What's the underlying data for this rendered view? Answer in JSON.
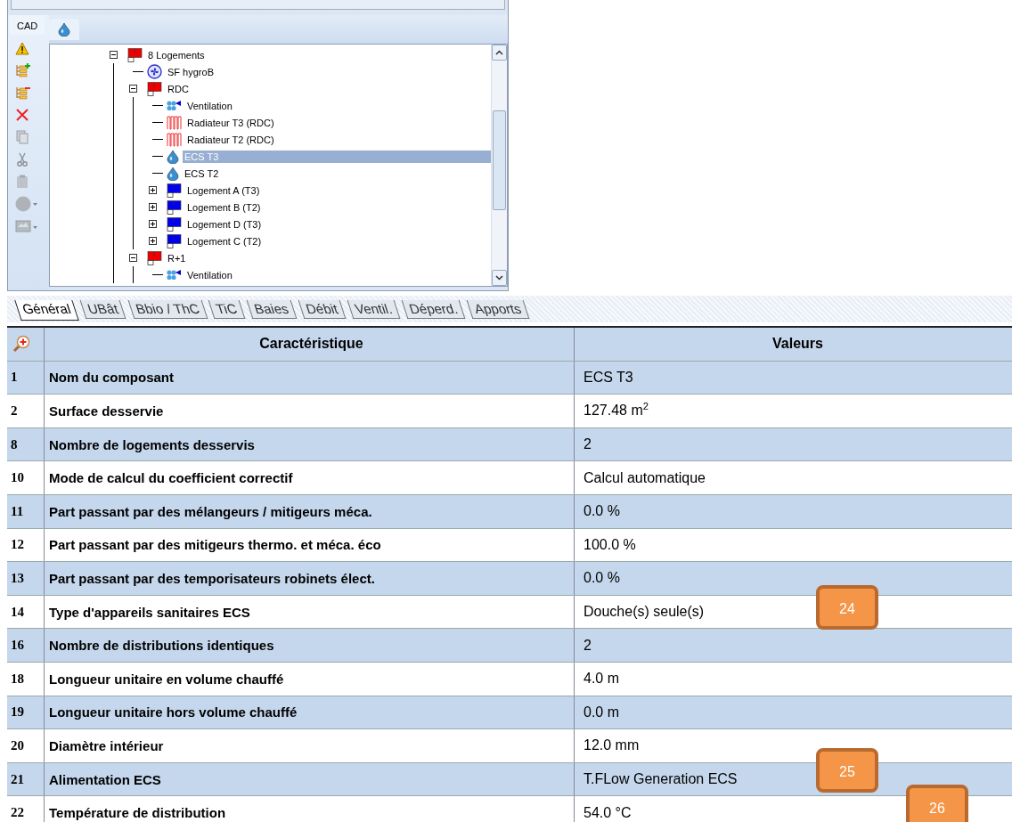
{
  "sidebar": {
    "tab": "CAD",
    "tools": [
      {
        "kind": "warning",
        "disabled": false
      },
      {
        "kind": "list-add",
        "disabled": false
      },
      {
        "kind": "list-remove",
        "disabled": false
      },
      {
        "kind": "delete",
        "disabled": false
      },
      {
        "kind": "copy",
        "disabled": true
      },
      {
        "kind": "cut",
        "disabled": true
      },
      {
        "kind": "paste",
        "disabled": true
      },
      {
        "kind": "circle-menu",
        "disabled": true
      },
      {
        "kind": "image-menu",
        "disabled": true
      }
    ]
  },
  "tree": {
    "items": [
      {
        "label": "8 Logements",
        "kind": "group-red",
        "expanded": true,
        "selected": false,
        "children": [
          {
            "label": "SF hygroB",
            "kind": "fan",
            "selected": false
          },
          {
            "label": "RDC",
            "kind": "group-red",
            "expanded": true,
            "selected": false,
            "children": [
              {
                "label": "Ventilation",
                "kind": "ventilation",
                "selected": false
              },
              {
                "label": "Radiateur T3 (RDC)",
                "kind": "radiator",
                "selected": false
              },
              {
                "label": "Radiateur T2 (RDC)",
                "kind": "radiator",
                "selected": false
              },
              {
                "label": "ECS T3",
                "kind": "drop",
                "selected": true
              },
              {
                "label": "ECS T2",
                "kind": "drop",
                "selected": false
              },
              {
                "label": "Logement A (T3)",
                "kind": "group-blue",
                "expanded": false,
                "selected": false
              },
              {
                "label": "Logement B (T2)",
                "kind": "group-blue",
                "expanded": false,
                "selected": false
              },
              {
                "label": "Logement D (T3)",
                "kind": "group-blue",
                "expanded": false,
                "selected": false
              },
              {
                "label": "Logement C (T2)",
                "kind": "group-blue",
                "expanded": false,
                "selected": false
              }
            ]
          },
          {
            "label": "R+1",
            "kind": "group-red",
            "expanded": true,
            "selected": false,
            "children": [
              {
                "label": "Ventilation",
                "kind": "ventilation",
                "selected": false
              }
            ]
          }
        ]
      }
    ]
  },
  "tabs": [
    {
      "label": "Général",
      "selected": true
    },
    {
      "label": "UBât",
      "selected": false
    },
    {
      "label": "Bbio / ThC",
      "selected": false
    },
    {
      "label": "TiC",
      "selected": false
    },
    {
      "label": "Baies",
      "selected": false
    },
    {
      "label": "Débit",
      "selected": false
    },
    {
      "label": "Ventil.",
      "selected": false
    },
    {
      "label": "Déperd.",
      "selected": false
    },
    {
      "label": "Apports",
      "selected": false
    }
  ],
  "table": {
    "columns": [
      "Caractéristique",
      "Valeurs"
    ],
    "rows": [
      {
        "number": "1",
        "label": "Nom du composant",
        "value": "ECS T3"
      },
      {
        "number": "2",
        "label": "Surface desservie",
        "value": "127.48 m$^{2}$"
      },
      {
        "number": "8",
        "label": "Nombre de logements desservis",
        "value": "2"
      },
      {
        "number": "10",
        "label": "Mode de calcul du coefficient correctif",
        "value": "Calcul automatique"
      },
      {
        "number": "11",
        "label": "Part passant par des mélangeurs / mitigeurs méca.",
        "value": "0.0 %"
      },
      {
        "number": "12",
        "label": "Part passant par des mitigeurs thermo. et méca. éco",
        "value": "100.0 %"
      },
      {
        "number": "13",
        "label": "Part passant par des temporisateurs robinets élect.",
        "value": "0.0 %"
      },
      {
        "number": "14",
        "label": "Type d'appareils sanitaires ECS",
        "value": "Douche(s) seule(s)"
      },
      {
        "number": "16",
        "label": "Nombre de distributions identiques",
        "value": "2"
      },
      {
        "number": "18",
        "label": "Longueur unitaire en volume chauffé",
        "value": "4.0 m"
      },
      {
        "number": "19",
        "label": "Longueur unitaire hors volume chauffé",
        "value": "0.0 m"
      },
      {
        "number": "20",
        "label": "Diamètre intérieur",
        "value": "12.0 mm"
      },
      {
        "number": "21",
        "label": "Alimentation ECS",
        "value": "T.FLow Generation ECS"
      },
      {
        "number": "22",
        "label": "Température de distribution",
        "value": "54.0 °C"
      }
    ]
  },
  "callouts": [
    "24",
    "25",
    "26"
  ]
}
